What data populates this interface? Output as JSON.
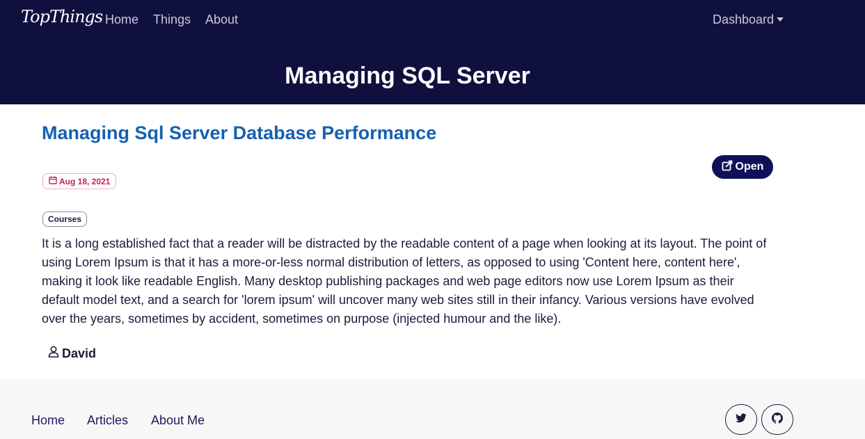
{
  "navbar": {
    "brand": "TopThings",
    "links": [
      "Home",
      "Things",
      "About"
    ],
    "dashboard_label": "Dashboard"
  },
  "hero": {
    "title": "Managing SQL Server"
  },
  "article": {
    "title": "Managing Sql Server Database Performance",
    "open_label": "Open",
    "date": "Aug 18, 2021",
    "tag": "Courses",
    "body": "It is a long established fact that a reader will be distracted by the readable content of a page when looking at its layout. The point of using Lorem Ipsum is that it has a more-or-less normal distribution of letters, as opposed to using 'Content here, content here', making it look like readable English. Many desktop publishing packages and web page editors now use Lorem Ipsum as their default model text, and a search for 'lorem ipsum' will uncover many web sites still in their infancy. Various versions have evolved over the years, sometimes by accident, sometimes on purpose (injected humour and the like).",
    "author": "David"
  },
  "footer": {
    "links": [
      "Home",
      "Articles",
      "About Me"
    ],
    "social_icons": [
      "twitter-icon",
      "github-icon"
    ]
  },
  "colors": {
    "hero_bg": "#10103f",
    "title_blue": "#1660b0",
    "button_navy": "#10105a",
    "date_red": "#c0264f"
  }
}
